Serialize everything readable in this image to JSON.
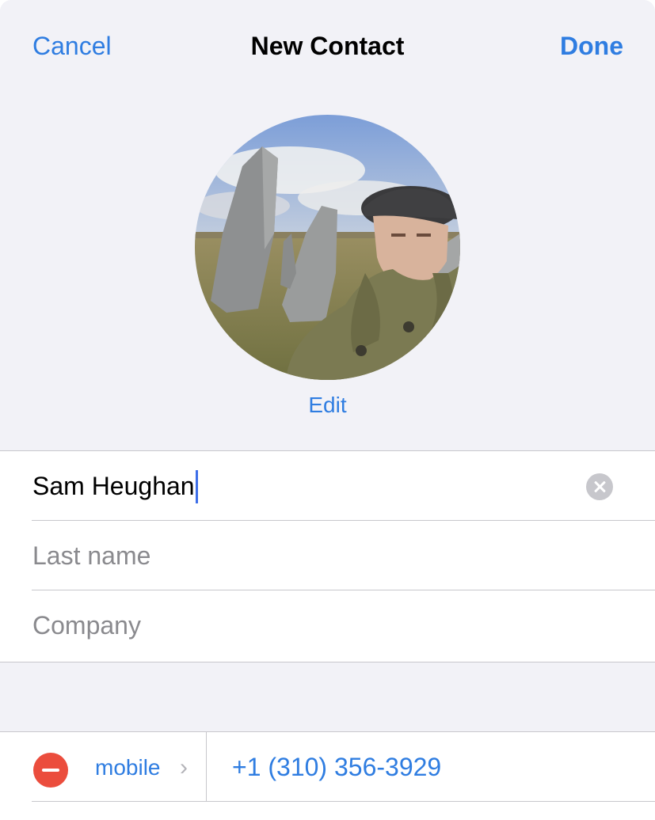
{
  "nav": {
    "cancel_label": "Cancel",
    "title": "New Contact",
    "done_label": "Done"
  },
  "photo": {
    "edit_label": "Edit"
  },
  "fields": {
    "first_name_value": "Sam Heughan",
    "last_name_placeholder": "Last name",
    "company_placeholder": "Company"
  },
  "phone": {
    "label": "mobile",
    "value": "+1 (310) 356-3929"
  },
  "colors": {
    "accent": "#2f7de1",
    "background": "#f2f2f7",
    "destructive": "#eb4d3d"
  }
}
